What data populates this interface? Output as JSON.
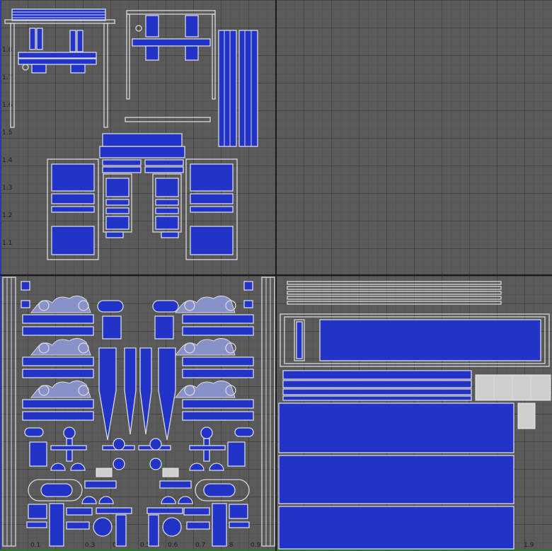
{
  "uv_editor": {
    "y_ticks": [
      "1.1",
      "1.2",
      "1.3",
      "1.4",
      "1.5",
      "1.6",
      "1.7",
      "1.8"
    ],
    "x_ticks": [
      "0.1",
      "0.3",
      "0.4",
      "0.5",
      "0.6",
      "0.7",
      "0.8",
      "0.9",
      "1.9"
    ],
    "colors": {
      "background": "#5a5a5a",
      "uv_face_fill": "#2233c8",
      "uv_edge": "#d8d8e0",
      "tile_border": "#1a1a1a",
      "v_axis": "#2a3aa8",
      "u_axis": "#2a7a2a"
    },
    "tiles": [
      "upper-left",
      "upper-right",
      "lower-left",
      "lower-right"
    ]
  }
}
